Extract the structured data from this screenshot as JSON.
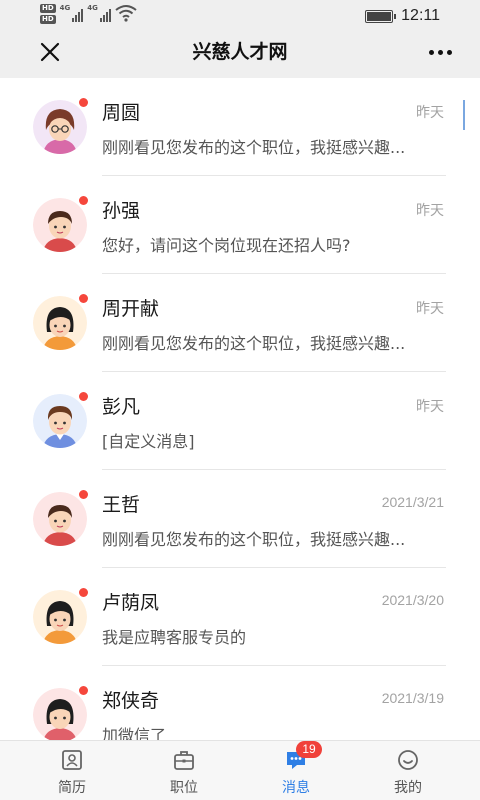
{
  "status_bar": {
    "hd_label": "HD",
    "net_label": "4G",
    "time": "12:11"
  },
  "header": {
    "title": "兴慈人才网"
  },
  "conversations": [
    {
      "name": "周圆",
      "date": "昨天",
      "message": "刚刚看见您发布的这个职位，我挺感兴趣...",
      "unread": true
    },
    {
      "name": "孙强",
      "date": "昨天",
      "message": "您好，请问这个岗位现在还招人吗?",
      "unread": true
    },
    {
      "name": "周开献",
      "date": "昨天",
      "message": "刚刚看见您发布的这个职位，我挺感兴趣...",
      "unread": true
    },
    {
      "name": "彭凡",
      "date": "昨天",
      "message": "[自定义消息]",
      "unread": true
    },
    {
      "name": "王哲",
      "date": "2021/3/21",
      "message": "刚刚看见您发布的这个职位，我挺感兴趣...",
      "unread": true
    },
    {
      "name": "卢荫凤",
      "date": "2021/3/20",
      "message": "我是应聘客服专员的",
      "unread": true
    },
    {
      "name": "郑侠奇",
      "date": "2021/3/19",
      "message": "加微信了",
      "unread": true
    }
  ],
  "tabbar": {
    "tabs": [
      {
        "label": "简历",
        "icon": "resume-icon"
      },
      {
        "label": "职位",
        "icon": "briefcase-icon"
      },
      {
        "label": "消息",
        "icon": "message-icon"
      },
      {
        "label": "我的",
        "icon": "smile-icon"
      }
    ],
    "message_badge": "19"
  },
  "colors": {
    "accent": "#2f7fe5",
    "unread_dot": "#f5473c",
    "badge": "#f0413a"
  }
}
